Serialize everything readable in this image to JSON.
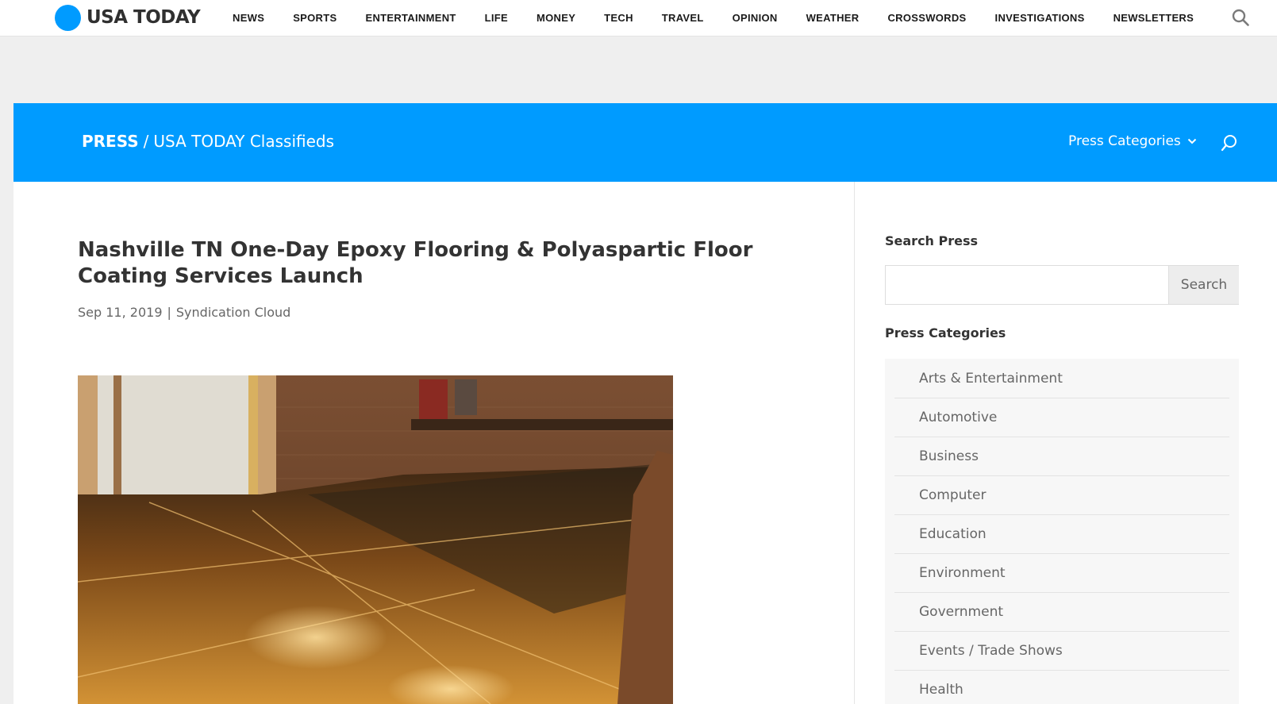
{
  "topnav": {
    "logo_text": "USA TODAY",
    "links": [
      "NEWS",
      "SPORTS",
      "ENTERTAINMENT",
      "LIFE",
      "MONEY",
      "TECH",
      "TRAVEL",
      "OPINION",
      "WEATHER",
      "CROSSWORDS",
      "INVESTIGATIONS",
      "NEWSLETTERS"
    ],
    "search_icon": "search-icon"
  },
  "banner": {
    "crumb_strong": "PRESS",
    "crumb_sep": "/",
    "crumb_rest": "USA TODAY Classifieds",
    "press_categories_label": "Press Categories",
    "chevron_icon": "chevron-down-icon",
    "search_icon": "search-icon"
  },
  "article": {
    "title": "Nashville TN One-Day Epoxy Flooring & Polyaspartic Floor Coating Services Launch",
    "date": "Sep 11, 2019",
    "meta_sep": "|",
    "author": "Syndication Cloud"
  },
  "sidebar": {
    "search_heading": "Search Press",
    "search_placeholder": "",
    "search_button": "Search",
    "categories_heading": "Press Categories",
    "categories": [
      "Arts & Entertainment",
      "Automotive",
      "Business",
      "Computer",
      "Education",
      "Environment",
      "Government",
      "Events / Trade Shows",
      "Health"
    ]
  },
  "colors": {
    "brand_blue": "#009bff",
    "text_dark": "#333333",
    "text_muted": "#666666"
  }
}
